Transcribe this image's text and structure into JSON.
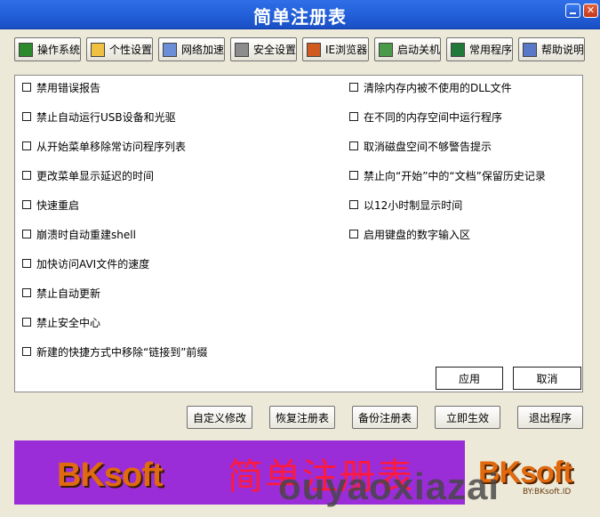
{
  "window": {
    "title": "简单注册表"
  },
  "toolbar": {
    "items": [
      {
        "label": "操作系统",
        "icon": "os-icon"
      },
      {
        "label": "个性设置",
        "icon": "folder-icon"
      },
      {
        "label": "网络加速",
        "icon": "network-icon"
      },
      {
        "label": "安全设置",
        "icon": "security-icon"
      },
      {
        "label": "IE浏览器",
        "icon": "browser-icon"
      },
      {
        "label": "启动关机",
        "icon": "startup-icon"
      },
      {
        "label": "常用程序",
        "icon": "program-icon"
      },
      {
        "label": "帮助说明",
        "icon": "help-icon"
      }
    ]
  },
  "options": {
    "left": [
      {
        "label": "禁用错误报告",
        "checked": false
      },
      {
        "label": "禁止自动运行USB设备和光驱",
        "checked": false
      },
      {
        "label": "从开始菜单移除常访问程序列表",
        "checked": false
      },
      {
        "label": "更改菜单显示延迟的时间",
        "checked": false
      },
      {
        "label": "快速重启",
        "checked": false
      },
      {
        "label": "崩溃时自动重建shell",
        "checked": false
      },
      {
        "label": "加快访问AVI文件的速度",
        "checked": false
      },
      {
        "label": "禁止自动更新",
        "checked": false
      },
      {
        "label": "禁止安全中心",
        "checked": false
      },
      {
        "label": "新建的快捷方式中移除“链接到”前缀",
        "checked": false
      }
    ],
    "right": [
      {
        "label": "清除内存内被不使用的DLL文件",
        "checked": false
      },
      {
        "label": "在不同的内存空间中运行程序",
        "checked": false
      },
      {
        "label": "取消磁盘空间不够警告提示",
        "checked": false
      },
      {
        "label": "禁止向“开始”中的“文档”保留历史记录",
        "checked": false
      },
      {
        "label": "以12小时制显示时间",
        "checked": false
      },
      {
        "label": "启用键盘的数字输入区",
        "checked": false
      }
    ]
  },
  "panel_buttons": {
    "apply": "应用",
    "cancel": "取消"
  },
  "bottom_buttons": {
    "custom": "自定义修改",
    "restore": "恢复注册表",
    "backup": "备份注册表",
    "apply_now": "立即生效",
    "exit": "退出程序"
  },
  "banner": {
    "logo": "BKsoft",
    "title": "简单注册表",
    "side_logo": "BKsoft",
    "side_sub": "BY:BKsoft.ID",
    "watermark": "ouyaoxiazai"
  },
  "colors": {
    "titlebar": "#2462dc",
    "banner": "#9b2dd9",
    "banner_title": "#ff1a3c",
    "logo": "#e06a10"
  }
}
